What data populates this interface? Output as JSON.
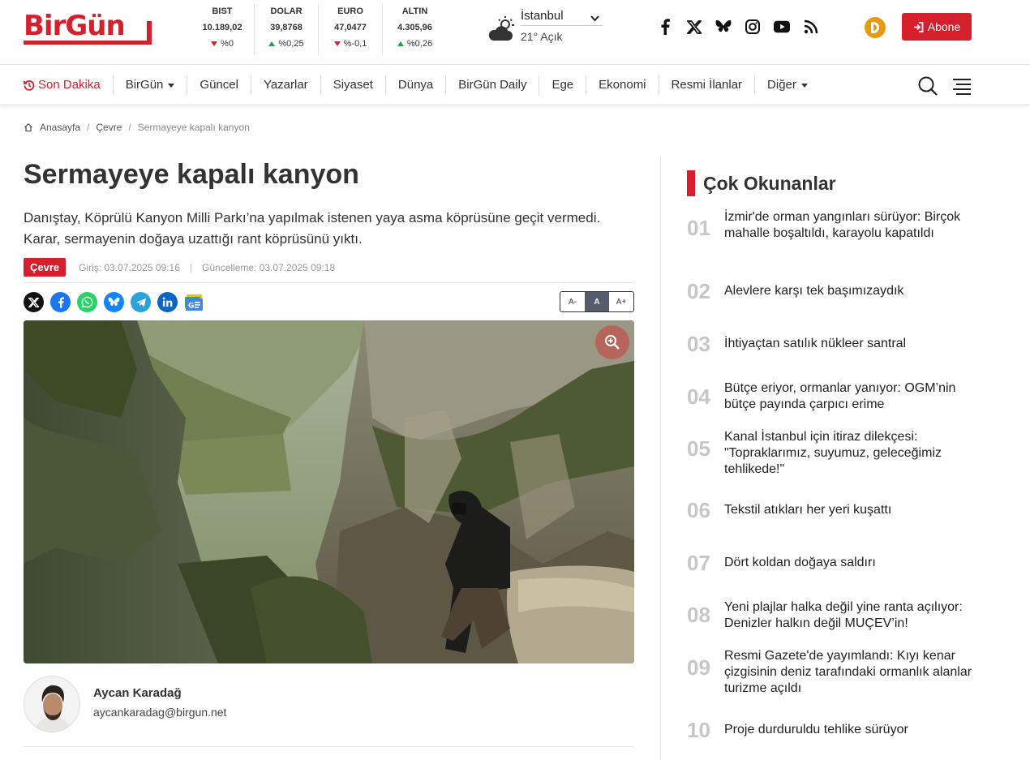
{
  "brand": {
    "logo_text": "BirGün"
  },
  "markets": [
    {
      "name": "BIST",
      "value": "10.189,02",
      "change": "%0",
      "dir": "down"
    },
    {
      "name": "DOLAR",
      "value": "39,8768",
      "change": "%0,25",
      "dir": "up"
    },
    {
      "name": "EURO",
      "value": "47,0477",
      "change": "%-0,1",
      "dir": "down"
    },
    {
      "name": "ALTIN",
      "value": "4.305,96",
      "change": "%0,26",
      "dir": "up"
    }
  ],
  "weather": {
    "city": "İstanbul",
    "temp": "21° Açık",
    "icon": "partly-cloudy-icon"
  },
  "header": {
    "subscribe_label": "Abone"
  },
  "nav": [
    {
      "label": "Son Dakika"
    },
    {
      "label": "BirGün"
    },
    {
      "label": "Güncel"
    },
    {
      "label": "Yazarlar"
    },
    {
      "label": "Siyaset"
    },
    {
      "label": "Dünya"
    },
    {
      "label": "BirGün Daily"
    },
    {
      "label": "Ege"
    },
    {
      "label": "Ekonomi"
    },
    {
      "label": "Resmi İlanlar"
    },
    {
      "label": "Diğer"
    }
  ],
  "breadcrumb": {
    "home": "Anasayfa",
    "section": "Çevre",
    "current": "Sermayeye kapalı kanyon"
  },
  "article": {
    "title": "Sermayeye kapalı kanyon",
    "lead": "Danıştay, Köprülü Kanyon Milli Parkı’na yapılmak istenen yaya asma köprüsüne geçit vermedi. Karar, sermayenin doğaya uzattığı rant köprüsünü yıktı.",
    "category": "Çevre",
    "published": "Giriş: 03.07.2025 09:16",
    "updated": "Güncelleme: 03.07.2025 09:18",
    "font_controls": {
      "smaller": "A-",
      "normal": "A",
      "larger": "A+"
    }
  },
  "author": {
    "name": "Aycan Karadağ",
    "email": "aycankaradag@birgun.net"
  },
  "sidebar": {
    "title": "Çok Okunanlar",
    "items": [
      {
        "num": "01",
        "text": "İzmir'de orman yangınları sürüyor: Birçok mahalle boşaltıldı, karayolu kapatıldı"
      },
      {
        "num": "02",
        "text": "Alevlere karşı tek başımızaydık"
      },
      {
        "num": "03",
        "text": "İhtiyaçtan satılık nükleer santral"
      },
      {
        "num": "04",
        "text": "Bütçe eriyor, ormanlar yanıyor: OGM’nin bütçe payında çarpıcı erime"
      },
      {
        "num": "05",
        "text": "Kanal İstanbul için itiraz dilekçesi: \"Topraklarımız, suyumuz, geleceğimiz tehlikede!\""
      },
      {
        "num": "06",
        "text": "Tekstil atıkları her yeri kuşattı"
      },
      {
        "num": "07",
        "text": "Dört koldan doğaya saldırı"
      },
      {
        "num": "08",
        "text": "Yeni plajlar halka değil yine ranta açılıyor: Denizler halkın değil MUÇEV’in!"
      },
      {
        "num": "09",
        "text": "Resmi Gazete'de yayımlandı: Kıyı kenar çizgisinin deniz tarafındaki ormanlık alanlar turizme açıldı"
      },
      {
        "num": "10",
        "text": "Proje durduruldu tehlike sürüyor"
      }
    ]
  },
  "colors": {
    "brand_red": "#d4202c",
    "gold": "#e59a10"
  }
}
